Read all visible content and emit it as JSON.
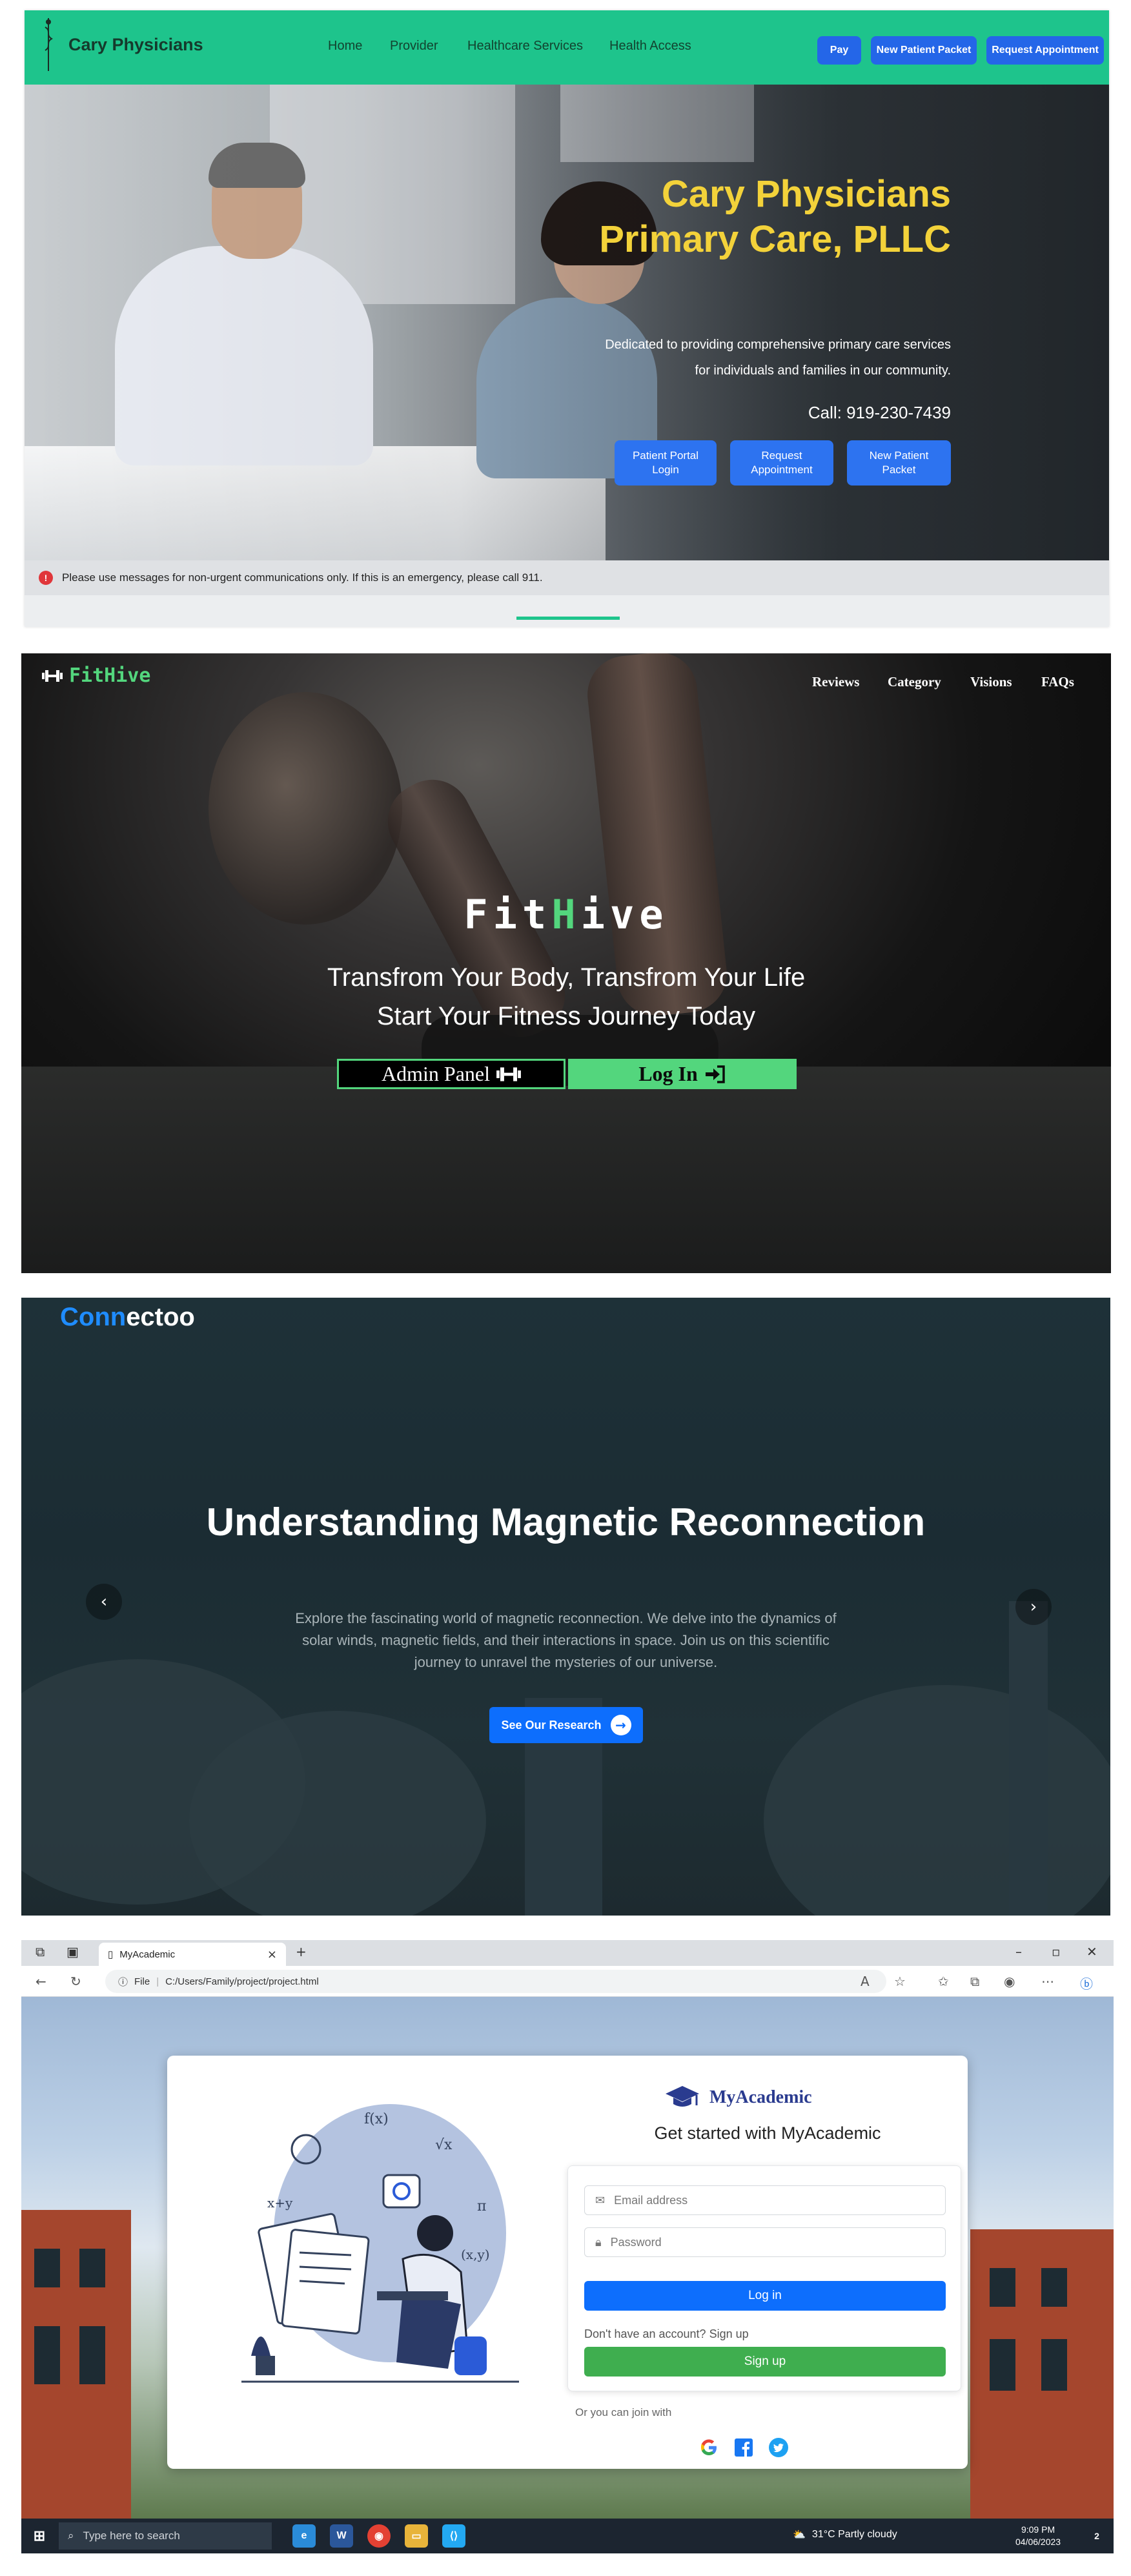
{
  "cary": {
    "brand": "Cary Physicians",
    "nav": [
      "Home",
      "Provider",
      "Healthcare Services",
      "Health Access"
    ],
    "buttons": {
      "pay": "Pay",
      "new_packet": "New Patient Packet",
      "request": "Request Appointment"
    },
    "hero": {
      "title": "Cary Physicians Primary Care, PLLC",
      "lead": "Dedicated to providing comprehensive primary care services for individuals and families in our community.",
      "call": "Call: 919-230-7439",
      "buttons": [
        "Patient Portal Login",
        "Request Appointment",
        "New Patient Packet"
      ]
    },
    "notice": "Please use messages for non-urgent communications only. If this is an emergency, please call 911.",
    "colors": {
      "nav": "#1ec48c",
      "title": "#f3d23a",
      "button": "#2466e8"
    }
  },
  "fithive": {
    "logo": "FitHive",
    "nav": [
      "Reviews",
      "Category",
      "Visions",
      "FAQs"
    ],
    "title_pre": "Fit",
    "title_h": "H",
    "title_post": "ive",
    "tagline1": "Transfrom Your Body, Transfrom Your Life",
    "tagline2": "Start Your Fitness Journey Today",
    "admin_label": "Admin Panel",
    "login_label": "Log In",
    "colors": {
      "accent": "#53d67d"
    }
  },
  "connectoo": {
    "brand_a": "Conn",
    "brand_b": "ectoo",
    "heading": "Understanding Magnetic Reconnection",
    "description": "Explore the fascinating world of magnetic reconnection. We delve into the dynamics of solar winds, magnetic fields, and their interactions in space. Join us on this scientific journey to unravel the mysteries of our universe.",
    "button": "See Our Research",
    "icons": {
      "prev": "chevron-left-icon",
      "next": "chevron-right-icon"
    },
    "colors": {
      "brand": "#1f8cff",
      "button": "#0d6efd"
    }
  },
  "browser": {
    "tab_title": "MyAcademic",
    "file_label": "File",
    "url": "C:/Users/Family/project/project.html",
    "page": {
      "brand": "MyAcademic",
      "subtitle": "Get started with MyAcademic",
      "email_placeholder": "Email address",
      "password_placeholder": "Password",
      "login": "Log in",
      "no_account": "Don't have an account? Sign up",
      "signup": "Sign up",
      "or_join": "Or you can join with",
      "social": [
        "google-icon",
        "facebook-icon",
        "twitter-icon"
      ]
    },
    "taskbar": {
      "search_placeholder": "Type here to search",
      "weather": "31°C  Partly cloudy",
      "time": "9:09 PM",
      "date": "04/06/2023",
      "notif_count": "2"
    }
  }
}
